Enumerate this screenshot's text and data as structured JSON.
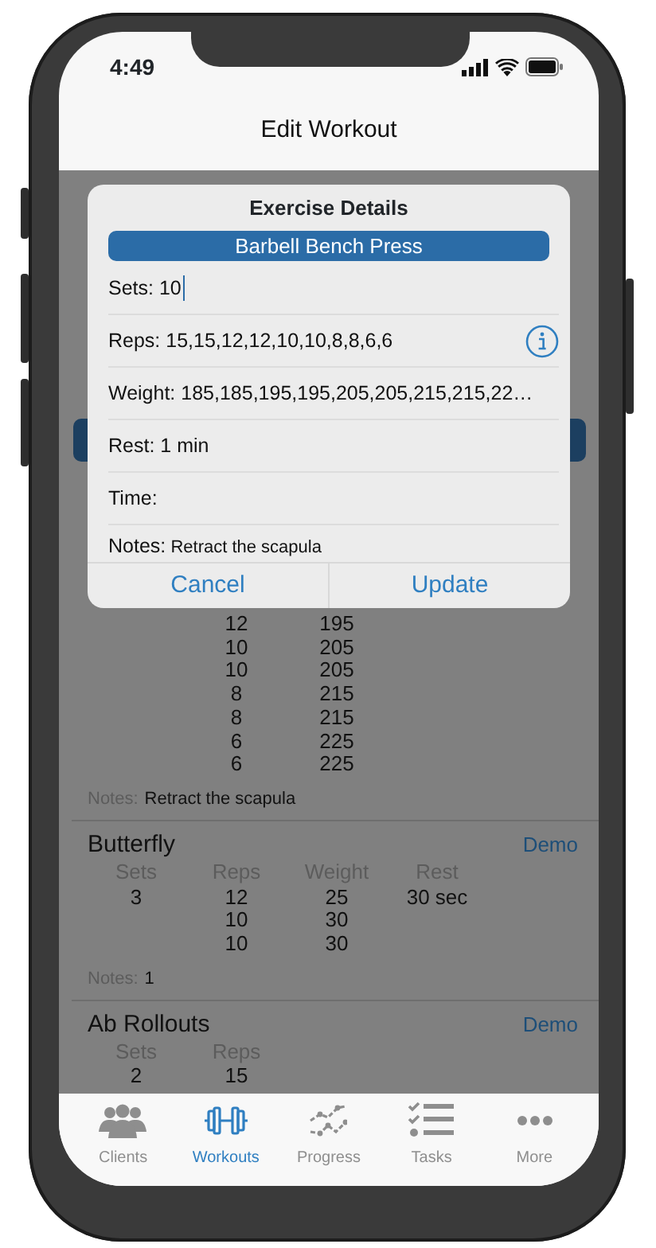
{
  "status_bar": {
    "time": "4:49"
  },
  "nav_bar": {
    "title": "Edit Workout"
  },
  "exercises": [
    {
      "rows": [
        {
          "reps": "12",
          "weight": "195"
        },
        {
          "reps": "10",
          "weight": "205"
        },
        {
          "reps": "10",
          "weight": "205"
        },
        {
          "reps": "8",
          "weight": "215"
        },
        {
          "reps": "8",
          "weight": "215"
        },
        {
          "reps": "6",
          "weight": "225"
        },
        {
          "reps": "6",
          "weight": "225"
        }
      ],
      "notes_label": "Notes:",
      "notes": "Retract the scapula"
    },
    {
      "name": "Butterfly",
      "demo": "Demo",
      "headers": [
        "Sets",
        "Reps",
        "Weight",
        "Rest"
      ],
      "rows": [
        {
          "sets": "3",
          "reps": "12",
          "weight": "25",
          "rest": "30 sec"
        },
        {
          "reps": "10",
          "weight": "30"
        },
        {
          "reps": "10",
          "weight": "30"
        }
      ],
      "notes_label": "Notes:",
      "notes": "1"
    },
    {
      "name": "Ab Rollouts",
      "demo": "Demo",
      "headers": [
        "Sets",
        "Reps"
      ],
      "rows": [
        {
          "sets": "2",
          "reps": "15"
        }
      ]
    }
  ],
  "dialog": {
    "title": "Exercise Details",
    "exercise": "Barbell Bench Press",
    "fields": [
      {
        "kind": "field",
        "label": "Sets:",
        "value": "10",
        "focused": true,
        "info": false
      },
      {
        "kind": "field",
        "label": "Reps:",
        "value": "15,15,12,12,10,10,8,8,6,6",
        "focused": false,
        "info": true
      },
      {
        "kind": "field",
        "label": "Weight:",
        "value": "185,185,195,195,205,205,215,215,22…",
        "focused": false,
        "info": false
      },
      {
        "kind": "field",
        "label": "Rest:",
        "value": "1 min",
        "focused": false,
        "info": false
      },
      {
        "kind": "field",
        "label": "Time:",
        "focused": false,
        "info": false
      },
      {
        "kind": "note",
        "label": "Notes:",
        "value": "Retract the scapula",
        "focused": false,
        "info": false
      }
    ],
    "buttons": [
      "Cancel",
      "Update"
    ]
  },
  "tab_bar": [
    {
      "label": "Clients",
      "selected": false
    },
    {
      "label": "Workouts",
      "selected": true
    },
    {
      "label": "Progress",
      "selected": false
    },
    {
      "label": "Tasks",
      "selected": false
    },
    {
      "label": "More",
      "selected": false
    }
  ]
}
